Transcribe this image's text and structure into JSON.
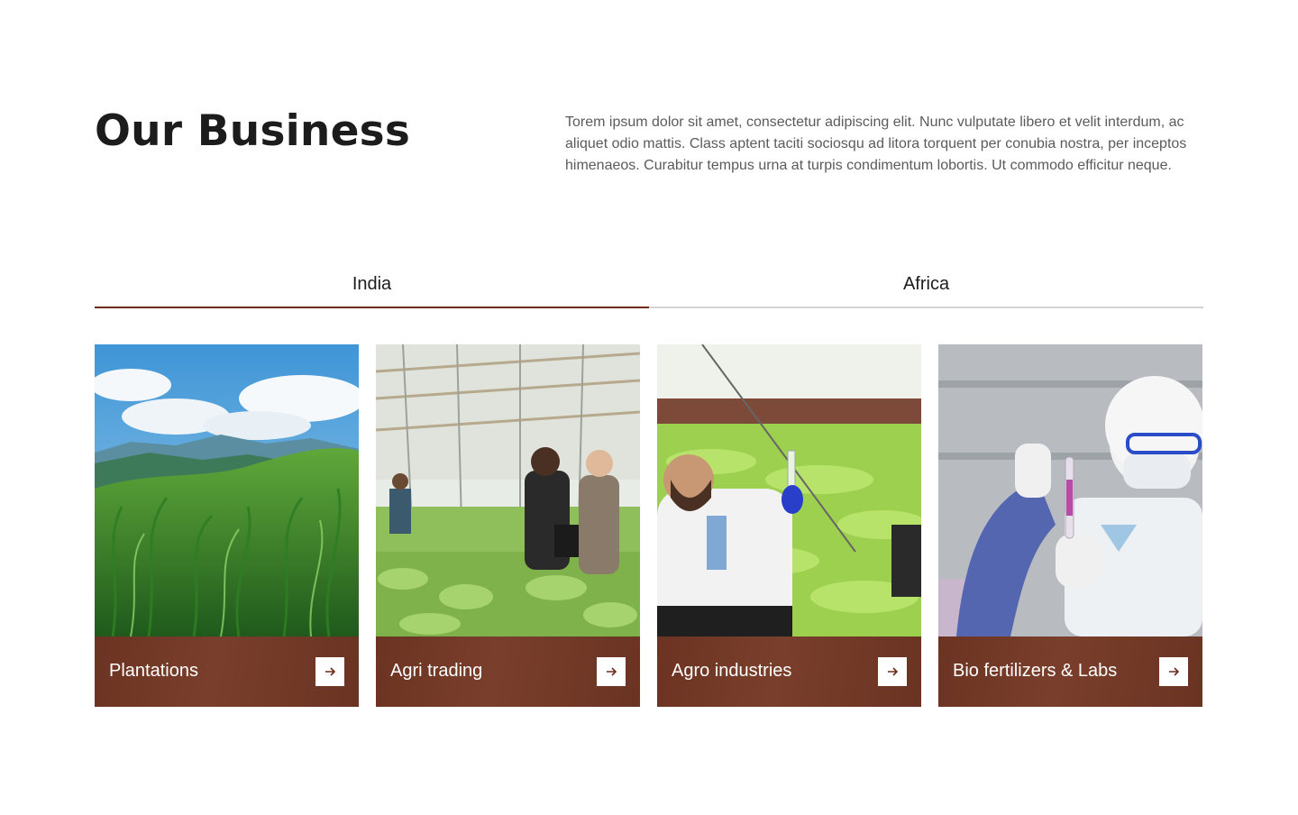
{
  "header": {
    "title": "Our Business",
    "description": "Torem ipsum dolor sit amet, consectetur adipiscing elit. Nunc vulputate libero et velit interdum, ac aliquet odio mattis. Class aptent taciti sociosqu ad litora torquent per conubia nostra, per inceptos himenaeos. Curabitur tempus urna at turpis condimentum lobortis. Ut commodo efficitur neque."
  },
  "tabs": [
    {
      "label": "India",
      "active": true
    },
    {
      "label": "Africa",
      "active": false
    }
  ],
  "cards": [
    {
      "title": "Plantations",
      "image": "green-hills-grass-photo",
      "icon": "arrow-right-icon"
    },
    {
      "title": "Agri trading",
      "image": "greenhouse-workers-photo",
      "icon": "arrow-right-icon"
    },
    {
      "title": "Agro industries",
      "image": "scientist-greenhouse-photo",
      "icon": "arrow-right-icon"
    },
    {
      "title": "Bio fertilizers & Labs",
      "image": "lab-researcher-photo",
      "icon": "arrow-right-icon"
    }
  ],
  "colors": {
    "accent": "#6e2a1a",
    "card_footer": "#733a27",
    "tab_inactive_line": "#d4d4d4",
    "heading": "#1c1c1c",
    "body_text": "#5b5b5b"
  }
}
